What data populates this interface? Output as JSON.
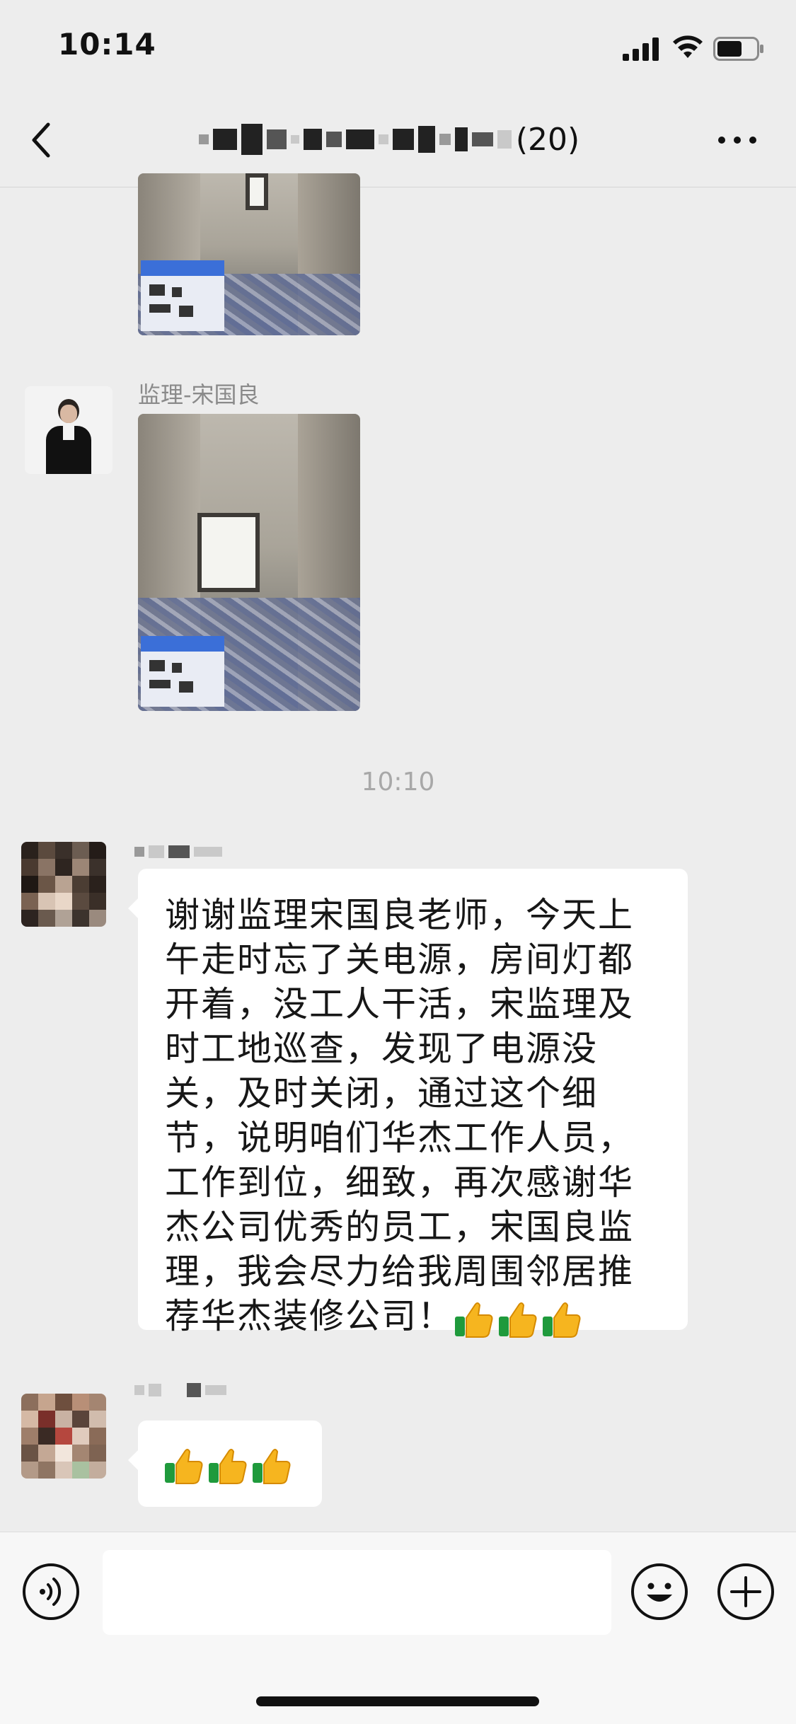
{
  "status_bar": {
    "time": "10:14"
  },
  "nav": {
    "title_count": "(20)",
    "icons": {
      "back": "chevron-left-icon",
      "more": "more-dots-icon"
    }
  },
  "messages": [
    {
      "type": "image",
      "sender": "",
      "note": "partial image"
    },
    {
      "type": "image",
      "sender": "监理-宋国良"
    },
    {
      "type": "time",
      "text": "10:10"
    },
    {
      "type": "text",
      "sender": "",
      "text": "谢谢监理宋国良老师，今天上午走时忘了关电源，房间灯都开着，没工人干活，宋监理及时工地巡查，发现了电源没关，及时关闭，通过这个细节，说明咱们华杰工作人员，工作到位，细致，再次感谢华杰公司优秀的员工，宋国良监理，我会尽力给我周围邻居推荐华杰装修公司！",
      "emojis": [
        "thumbs-up",
        "thumbs-up",
        "thumbs-up"
      ]
    },
    {
      "type": "emoji",
      "sender": "",
      "emojis": [
        "thumbs-up",
        "thumbs-up",
        "thumbs-up"
      ]
    }
  ],
  "input_bar": {
    "placeholder": "",
    "icons": [
      "voice-icon",
      "emoji-face-icon",
      "plus-icon"
    ]
  },
  "colors": {
    "background": "#ededed",
    "bubble": "#ffffff",
    "timestamp": "#a8a8a8",
    "sender": "#8a8a8a"
  }
}
